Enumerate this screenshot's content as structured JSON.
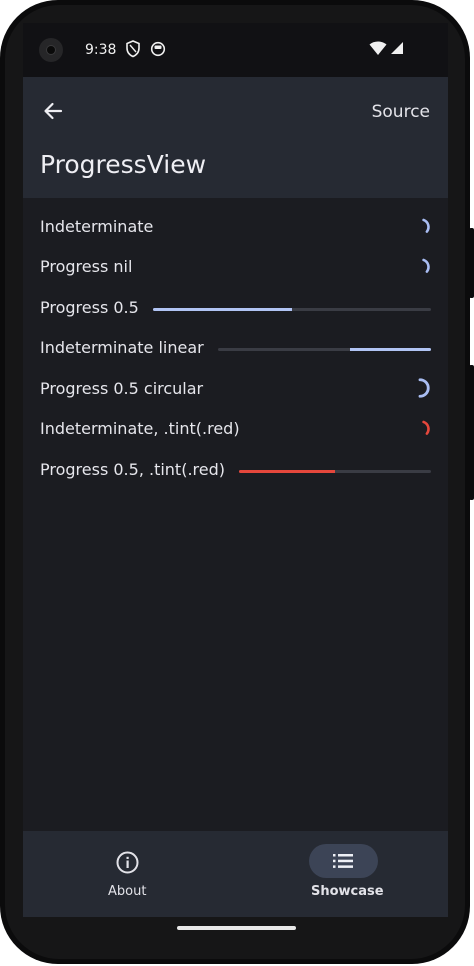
{
  "status_bar": {
    "time": "9:38"
  },
  "app_bar": {
    "source_label": "Source",
    "title": "ProgressView"
  },
  "rows": [
    {
      "label": "Indeterminate",
      "kind": "circular-indeterminate",
      "color": "#a9bdf2"
    },
    {
      "label": "Progress nil",
      "kind": "circular-indeterminate",
      "color": "#a9bdf2"
    },
    {
      "label": "Progress 0.5",
      "kind": "linear",
      "progress": 0.5,
      "color": "#b1c4f4"
    },
    {
      "label": "Indeterminate linear",
      "kind": "linear-indeterminate",
      "color": "#b1c4f4"
    },
    {
      "label": "Progress 0.5 circular",
      "kind": "circular",
      "progress": 0.5,
      "color": "#a9bdf2"
    },
    {
      "label": "Indeterminate, .tint(.red)",
      "kind": "circular-indeterminate",
      "color": "#e5473c"
    },
    {
      "label": "Progress 0.5, .tint(.red)",
      "kind": "linear",
      "progress": 0.5,
      "color": "#e5473c"
    }
  ],
  "bottom_nav": {
    "items": [
      {
        "label": "About",
        "icon": "info-circle-icon",
        "selected": false
      },
      {
        "label": "Showcase",
        "icon": "list-icon",
        "selected": true
      }
    ]
  },
  "colors": {
    "background": "#1b1c21",
    "surface": "#262a33",
    "accent": "#b1c4f4",
    "tint_red": "#e5473c",
    "nav_indicator": "#3c4456"
  }
}
